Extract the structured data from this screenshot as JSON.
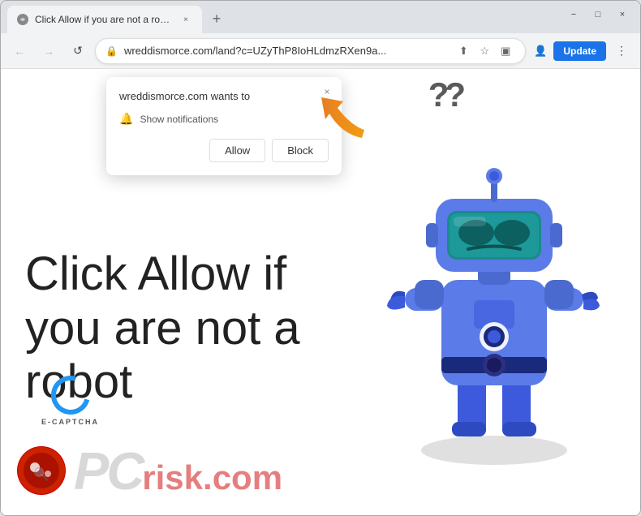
{
  "browser": {
    "tab": {
      "favicon_alt": "favicon",
      "title": "Click Allow if you are not a robot",
      "close_label": "×"
    },
    "new_tab_label": "+",
    "window_controls": {
      "minimize": "−",
      "maximize": "□",
      "close": "×"
    },
    "nav": {
      "back_label": "←",
      "forward_label": "→",
      "reload_label": "↺",
      "address": "wreddismorce.com/land?c=UZyThP8IoHLdmzRXen9a...",
      "share_label": "⬆",
      "bookmark_label": "☆",
      "sidebar_label": "▣",
      "profile_label": "👤",
      "update_label": "Update",
      "menu_label": "⋮"
    }
  },
  "notification_popup": {
    "header": "wreddismorce.com wants to",
    "row_icon": "🔔",
    "row_text": "Show notifications",
    "allow_label": "Allow",
    "block_label": "Block",
    "close_label": "×"
  },
  "page": {
    "main_text": "Click Allow if\nyou are not a\nrobot",
    "question_marks": "??",
    "ecaptcha_label": "E-CAPTCHA",
    "pcrisk_pc": "PC",
    "pcrisk_suffix": "risk.com"
  }
}
